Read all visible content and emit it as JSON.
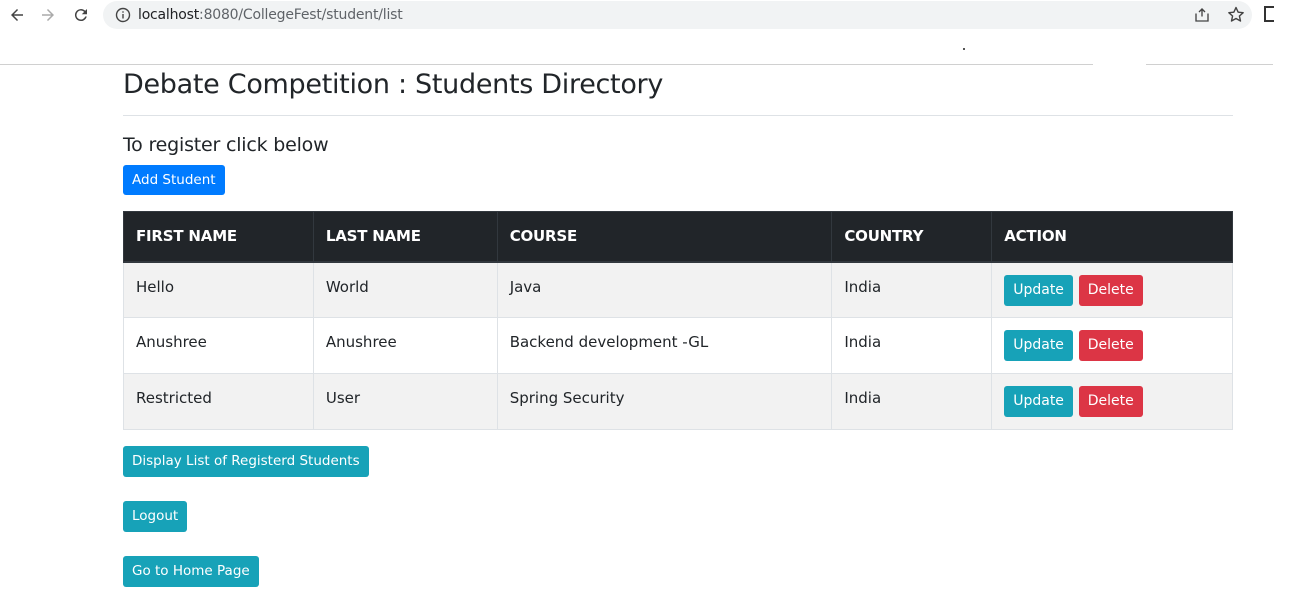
{
  "browser": {
    "url_host": "localhost",
    "url_path": ":8080/CollegeFest/student/list"
  },
  "page": {
    "title": "Debate Competition : Students Directory",
    "subtitle": "To register click below",
    "add_button": "Add Student"
  },
  "table": {
    "headers": [
      "FIRST NAME",
      "LAST NAME",
      "COURSE",
      "COUNTRY",
      "ACTION"
    ],
    "rows": [
      {
        "first": "Hello",
        "last": "World",
        "course": "Java",
        "country": "India"
      },
      {
        "first": "Anushree",
        "last": "Anushree",
        "course": "Backend development -GL",
        "country": "India"
      },
      {
        "first": "Restricted",
        "last": "User",
        "course": "Spring Security",
        "country": "India"
      }
    ],
    "update_label": "Update",
    "delete_label": "Delete"
  },
  "footer_buttons": {
    "display_list": "Display List of Registerd Students",
    "logout": "Logout",
    "home": "Go to Home Page"
  },
  "colors": {
    "primary": "#007bff",
    "info": "#17a2b8",
    "danger": "#dc3545",
    "table_header": "#212529"
  }
}
